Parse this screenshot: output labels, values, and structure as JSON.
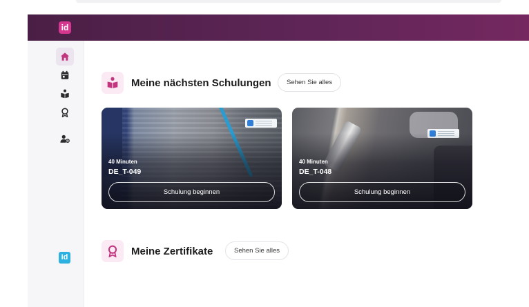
{
  "colors": {
    "topbar": "#5e2556",
    "brand_pink": "#d6378e",
    "brand_blue": "#2bb0e0",
    "section_icon_bg": "#fbe9f3"
  },
  "topbar": {
    "logo_text": "id"
  },
  "sidebar": {
    "items": [
      {
        "icon": "home-icon",
        "active": true
      },
      {
        "icon": "calendar-icon",
        "active": false
      },
      {
        "icon": "book-reader-icon",
        "active": false
      },
      {
        "icon": "award-icon",
        "active": false
      },
      {
        "icon": "user-settings-icon",
        "active": false
      }
    ],
    "logo_text": "id"
  },
  "trainings": {
    "title": "Meine nächsten Schulungen",
    "see_all": "Sehen Sie alles",
    "cards": [
      {
        "duration": "40 Minuten",
        "code": "DE_T-049",
        "button": "Schulung beginnen"
      },
      {
        "duration": "40 Minuten",
        "code": "DE_T-048",
        "button": "Schulung beginnen"
      }
    ]
  },
  "certificates": {
    "title": "Meine Zertifikate",
    "see_all": "Sehen Sie alles"
  }
}
